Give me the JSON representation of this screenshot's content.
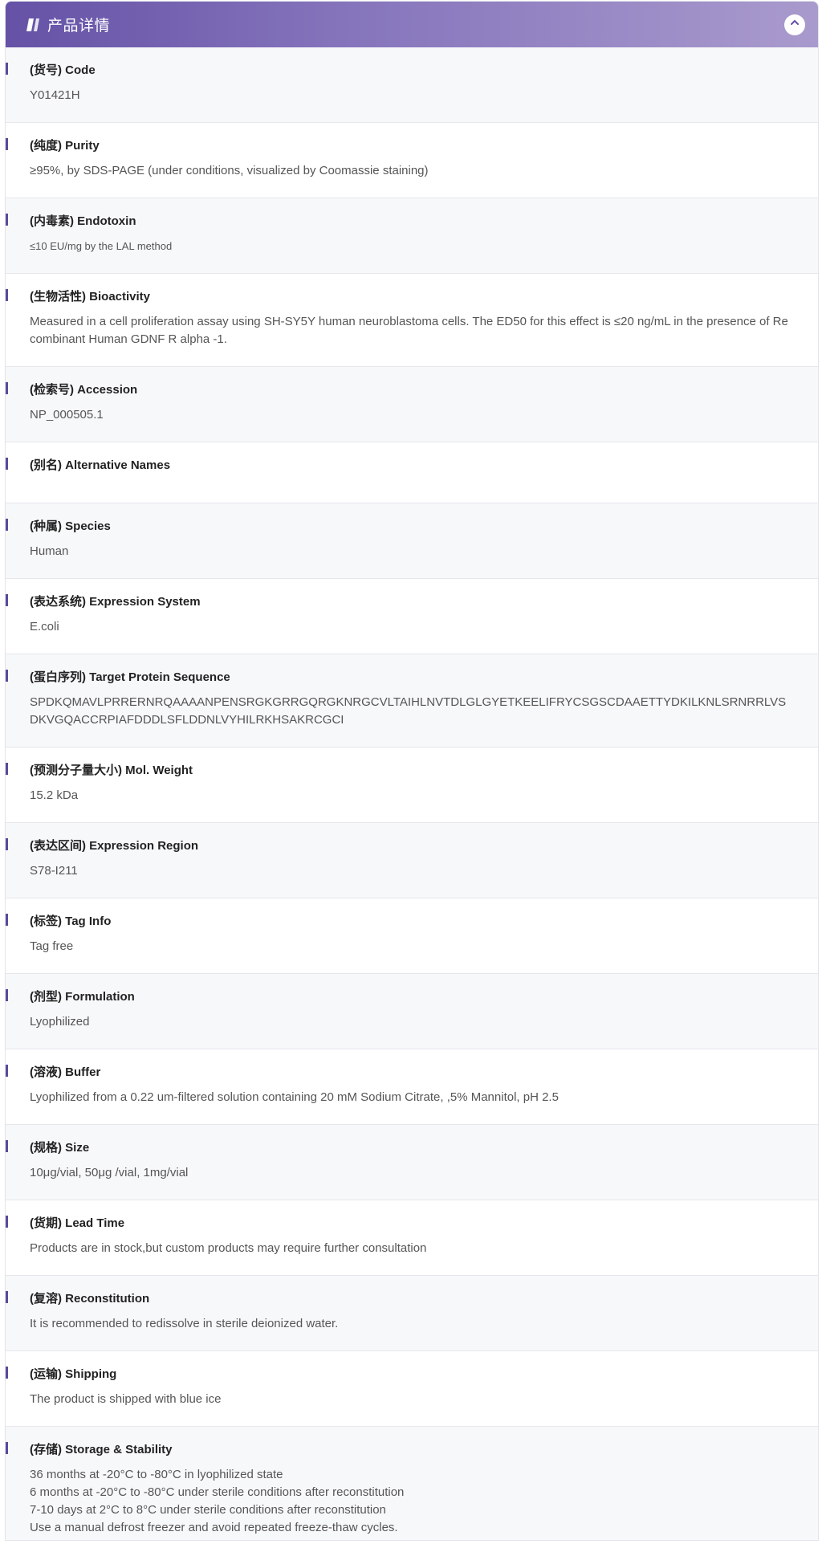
{
  "header": {
    "title": "产品详情"
  },
  "rows": [
    {
      "label": "(货号) Code",
      "value": "Y01421H"
    },
    {
      "label": "(纯度) Purity",
      "value": "≥95%, by SDS-PAGE (under conditions, visualized by Coomassie staining)"
    },
    {
      "label": "(内毒素) Endotoxin",
      "value": "≤10 EU/mg by the LAL method"
    },
    {
      "label": "(生物活性) Bioactivity",
      "value": "Measured in a cell proliferation assay using SH-SY5Y human neuroblastoma cells. The ED50 for this effect is ≤20 ng/mL in the presence of Recombinant Human GDNF R alpha -1."
    },
    {
      "label": "(检索号) Accession",
      "value": "NP_000505.1"
    },
    {
      "label": "(别名) Alternative Names",
      "value": ""
    },
    {
      "label": "(种属) Species",
      "value": "Human"
    },
    {
      "label": "(表达系统) Expression System",
      "value": "E.coli"
    },
    {
      "label": "(蛋白序列) Target Protein Sequence",
      "value": "SPDKQMAVLPRRERNRQAAAANPENSRGKGRRGQRGKNRGCVLTAIHLNVTDLGLGYETKEELIFRYCSGSCDAAETTYDKILKNLSRNRRLVSDKVGQACCRPIAFDDDLSFLDDNLVYHILRKHSAKRCGCI"
    },
    {
      "label": "(预测分子量大小) Mol. Weight",
      "value": "15.2 kDa"
    },
    {
      "label": "(表达区间) Expression Region",
      "value": "S78-I211"
    },
    {
      "label": "(标签) Tag Info",
      "value": "Tag free"
    },
    {
      "label": "(剂型) Formulation",
      "value": "Lyophilized"
    },
    {
      "label": "(溶液) Buffer",
      "value": "Lyophilized from a 0.22 um-filtered solution containing 20 mM Sodium Citrate, ,5% Mannitol, pH 2.5"
    },
    {
      "label": "(规格) Size",
      "value": "10μg/vial, 50μg /vial, 1mg/vial"
    },
    {
      "label": "(货期) Lead Time",
      "value": "Products are in stock,but custom products may require further consultation"
    },
    {
      "label": "(复溶) Reconstitution",
      "value": "It is recommended to redissolve in sterile deionized water."
    },
    {
      "label": "(运输) Shipping",
      "value": "The product is shipped with blue ice"
    },
    {
      "label": "(存储) Storage & Stability",
      "value": "36 months at -20°C to -80°C in lyophilized state\n6 months at -20°C to -80°C under sterile conditions after reconstitution\n7-10 days at 2°C to 8°C under sterile conditions after reconstitution\nUse a manual defrost freezer and avoid repeated freeze-thaw cycles."
    }
  ]
}
